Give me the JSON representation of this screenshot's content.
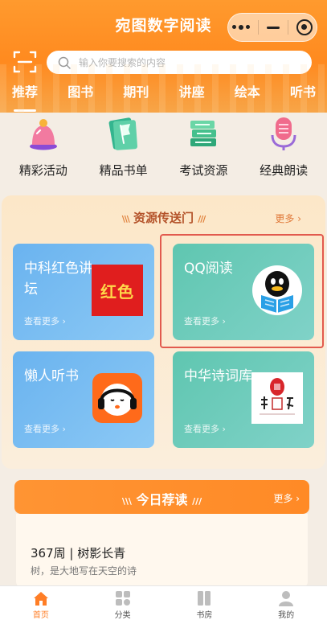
{
  "app": {
    "title": "宛图数字阅读"
  },
  "search": {
    "placeholder": "输入你要搜索的内容"
  },
  "tabs": [
    {
      "label": "推荐",
      "active": true
    },
    {
      "label": "图书"
    },
    {
      "label": "期刊"
    },
    {
      "label": "讲座"
    },
    {
      "label": "绘本"
    },
    {
      "label": "听书"
    }
  ],
  "quick_entries": [
    {
      "label": "精彩活动",
      "icon": "trophy-bell-icon"
    },
    {
      "label": "精品书单",
      "icon": "book-flag-icon"
    },
    {
      "label": "考试资源",
      "icon": "books-stack-icon"
    },
    {
      "label": "经典朗读",
      "icon": "microphone-icon"
    }
  ],
  "portal": {
    "title": "资源传送门",
    "more": "更多",
    "cards": [
      {
        "title": "中科红色讲坛",
        "more": "查看更多",
        "image_text": "红色",
        "color": "blue"
      },
      {
        "title": "QQ阅读",
        "more": "查看更多",
        "color": "green"
      },
      {
        "title": "懒人听书",
        "more": "查看更多",
        "color": "blue"
      },
      {
        "title": "中华诗词库",
        "more": "查看更多",
        "color": "green"
      }
    ]
  },
  "today": {
    "title": "今日荐读",
    "more": "更多",
    "item_title": "367周 | 树影长青",
    "item_sub": "树，是大地写在天空的诗"
  },
  "bottom_nav": [
    {
      "label": "首页",
      "active": true,
      "icon": "home-icon"
    },
    {
      "label": "分类",
      "icon": "category-icon"
    },
    {
      "label": "书房",
      "icon": "bookshelf-icon"
    },
    {
      "label": "我的",
      "icon": "user-icon"
    }
  ],
  "colors": {
    "accent": "#ff8a1f",
    "highlight": "#e25a4e",
    "portal_title": "#b4532a"
  }
}
